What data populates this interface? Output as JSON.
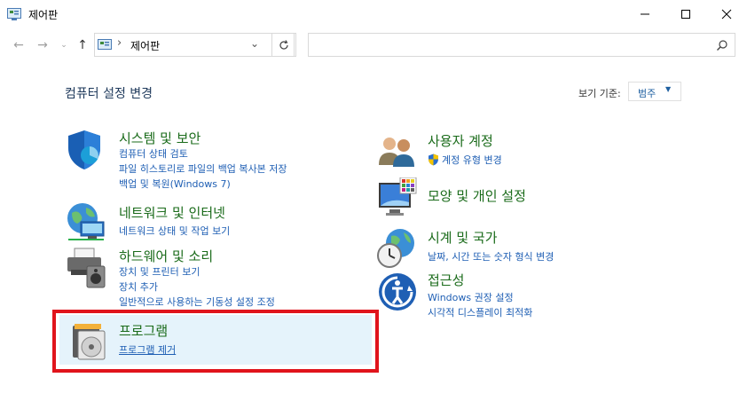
{
  "window": {
    "title": "제어판"
  },
  "address": {
    "path": "제어판",
    "search_placeholder": ""
  },
  "heading": "컴퓨터 설정 변경",
  "view_by": {
    "label": "보기 기준:",
    "value": "범주"
  },
  "categories_left": [
    {
      "title": "시스템 및 보안",
      "icon": "shield-icon",
      "links": [
        "컴퓨터 상태 검토",
        "파일 히스토리로 파일의 백업 복사본 저장",
        "백업 및 복원(Windows 7)"
      ]
    },
    {
      "title": "네트워크 및 인터넷",
      "icon": "network-globe-icon",
      "links": [
        "네트워크 상태 및 작업 보기"
      ]
    },
    {
      "title": "하드웨어 및 소리",
      "icon": "printer-speaker-icon",
      "links": [
        "장치 및 프린터 보기",
        "장치 추가",
        "일반적으로 사용하는 기동성 설정 조정"
      ]
    },
    {
      "title": "프로그램",
      "icon": "program-disc-icon",
      "links": [
        "프로그램 제거"
      ]
    }
  ],
  "categories_right": [
    {
      "title": "사용자 계정",
      "icon": "users-icon",
      "links": [
        "계정 유형 변경"
      ]
    },
    {
      "title": "모양 및 개인 설정",
      "icon": "monitor-palette-icon",
      "links": []
    },
    {
      "title": "시계 및 국가",
      "icon": "clock-globe-icon",
      "links": [
        "날짜, 시간 또는 숫자 형식 변경"
      ]
    },
    {
      "title": "접근성",
      "icon": "accessibility-icon",
      "links": [
        "Windows 권장 설정",
        "시각적 디스플레이 최적화"
      ]
    }
  ],
  "colors": {
    "highlight_border": "#e0141c",
    "link": "#1f5fb4",
    "category_title": "#1a6b1a"
  }
}
